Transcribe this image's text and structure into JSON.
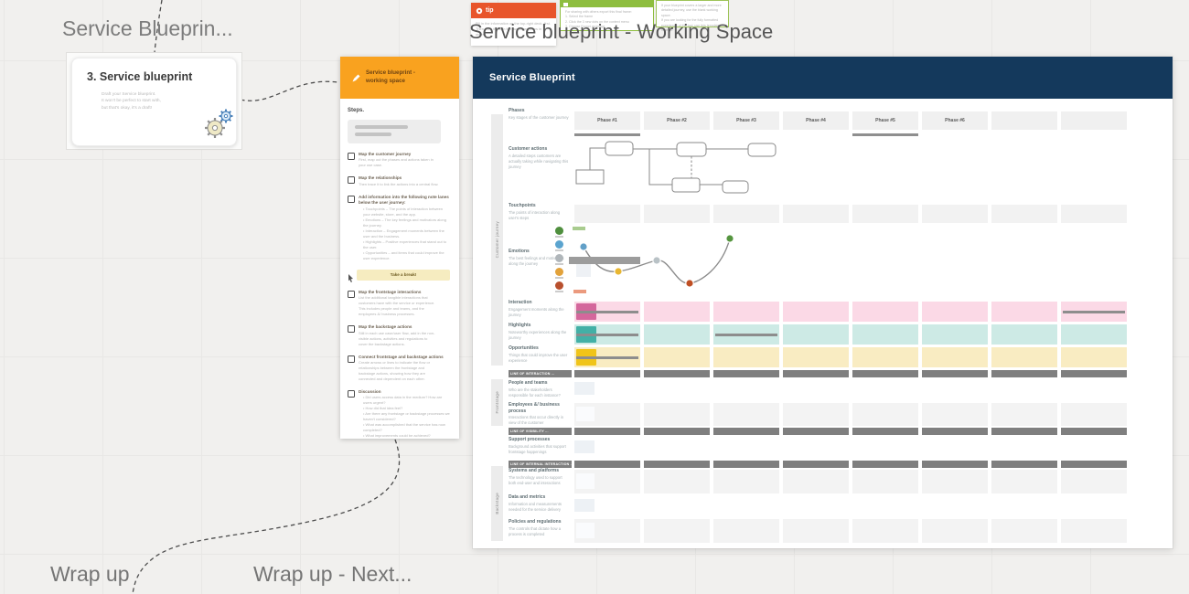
{
  "frames": {
    "left_title": "Service Blueprin...",
    "main_title": "Service blueprint - Working Space",
    "wrap_up_title": "Wrap up",
    "wrap_up_next_title": "Wrap up - Next..."
  },
  "intro_card": {
    "title": "3. Service blueprint",
    "body_lines": [
      "Draft your Service blueprint.",
      "It won't be perfect to start with,",
      "but that's okay, it's a draft!"
    ]
  },
  "tip_card": {
    "label": "tip",
    "body_lines": [
      "Fill in the information on the top-right deck, first.",
      "Then work through the numbered steps in order."
    ]
  },
  "export_card": {
    "body_lines": [
      "For sharing with others export this final frame:",
      "1. Select the frame",
      "2. Click the 3 new dots on the context menu",
      "3. Choose Export as image"
    ]
  },
  "note_card": {
    "body_lines": [
      "If your blueprint covers a larger and more",
      "detailed journey, use the blank working space.",
      "If you are looking for the fully formatted",
      "experience of the tool, use this template instead."
    ]
  },
  "steps_card": {
    "header_title": "Service blueprint - working space",
    "steps_label": "Steps.",
    "break_label": "Take a break!",
    "items": [
      {
        "title": "Map the customer journey",
        "body": [
          "First, map out the phases and actions taken in",
          "your use case."
        ]
      },
      {
        "title": "Map the relationships",
        "body": [
          "Then trace it to link the actions into a central flow."
        ]
      },
      {
        "title": "Add information into the following note lanes below the user journey:",
        "bullets": [
          "Touchpoints – The points of interaction between your website, store, and the app.",
          "Emotions – The key feelings and motivators along the journey.",
          "Interaction – Engagement moments between the user and the business.",
          "Highlights – Positive experiences that stand out to the user.",
          "Opportunities – and items that could improve the user experience."
        ]
      },
      {
        "title": "Map the frontstage interactions",
        "body": [
          "List the additional tangible interactions that",
          "customers have with the service or experience.",
          "This includes people and teams, and the",
          "employees &/ business processes."
        ]
      },
      {
        "title": "Map the backstage actions",
        "body": [
          "Still in each use case/user flow, add in the non-",
          "visible actions, activities and regulations to",
          "cover the backstage actions."
        ]
      },
      {
        "title": "Connect frontstage and backstage actions",
        "body": [
          "Create arrows or lines to indicate the flow or",
          "relationships between the frontstage and",
          "backstage actions, showing how they are",
          "connected and dependent on each other."
        ]
      },
      {
        "title": "Discussion",
        "bullets": [
          "Did users access data in the medium? How are users urgent?",
          "How did that idea feel?",
          "Are there any frontstage or backstage processes we haven't considered?",
          "What was accomplished that the service has now completed?",
          "What improvements could be achieved?"
        ]
      }
    ]
  },
  "board": {
    "title": "Service Blueprint",
    "phases": [
      "Phase #1",
      "Phase #2",
      "Phase #3",
      "Phase #4",
      "Phase #5",
      "Phase #6",
      "",
      ""
    ],
    "divider_lines": [
      "LINE OF INTERACTION",
      "LINE OF VISIBILITY",
      "LINE OF INTERNAL INTERACTION"
    ],
    "sections": {
      "customer_journey": "Customer journey",
      "frontstage": "Frontstage",
      "backstage": "Backstage"
    },
    "row_labels": {
      "phases": {
        "t": "Phases",
        "d": "Key stages of the customer journey"
      },
      "customer_actions": {
        "t": "Customer actions",
        "d": "A detailed steps customers are actually taking while navigating this journey"
      },
      "touchpoints": {
        "t": "Touchpoints",
        "d": "The points of interaction along user's steps"
      },
      "emotions": {
        "t": "Emotions",
        "d": "The best feelings and motivators along the journey"
      },
      "interaction": {
        "t": "Interaction",
        "d": "Engagement moments along the journey"
      },
      "highlights": {
        "t": "Highlights",
        "d": "Noteworthy experiences along the journey"
      },
      "opportunities": {
        "t": "Opportunities",
        "d": "Things that could improve the user experience"
      },
      "people_teams": {
        "t": "People and teams",
        "d": "Who are the stakeholders responsible for each instance?"
      },
      "employees": {
        "t": "Employees &/ business process",
        "d": "Interactions that occur directly in view of the customer"
      },
      "support": {
        "t": "Support processes",
        "d": "Background activities that support frontstage happenings"
      },
      "systems": {
        "t": "Systems and platforms",
        "d": "The technology used to support both end-user and interactions"
      },
      "data_metrics": {
        "t": "Data and metrics",
        "d": "Information and measurements needed for the service delivery"
      },
      "policies": {
        "t": "Policies and regulations",
        "d": "The controls that dictate how a process is completed"
      }
    },
    "emotion_scale": [
      "very-happy",
      "happy",
      "neutral",
      "unhappy",
      "angry"
    ]
  },
  "colors": {
    "board_header": "#14395c",
    "steps_header": "#f9a21f",
    "tip_header": "#e8552b",
    "export_green": "#8ebe3f",
    "interaction_row": "#fbd9e6",
    "interaction_sticky": "#d4679c",
    "highlights_row": "#cdeae5",
    "highlights_sticky": "#43b0a6",
    "opportunities_row": "#f9ecc2",
    "opportunities_sticky": "#f0c419",
    "divider_bar": "#7f7f7f",
    "cell_gray": "#f2f2f2",
    "emotions": [
      "#4f8f3e",
      "#5ba4cf",
      "#b0b6ba",
      "#e2a23b",
      "#b8502e"
    ],
    "curve_dots": [
      "#62a0c8",
      "#e8b631",
      "#b9c2c6",
      "#bf4f24",
      "#55953f"
    ],
    "emotion_positive_marker": "#a9cc8f",
    "emotion_negative_marker": "#eb9a7e"
  }
}
